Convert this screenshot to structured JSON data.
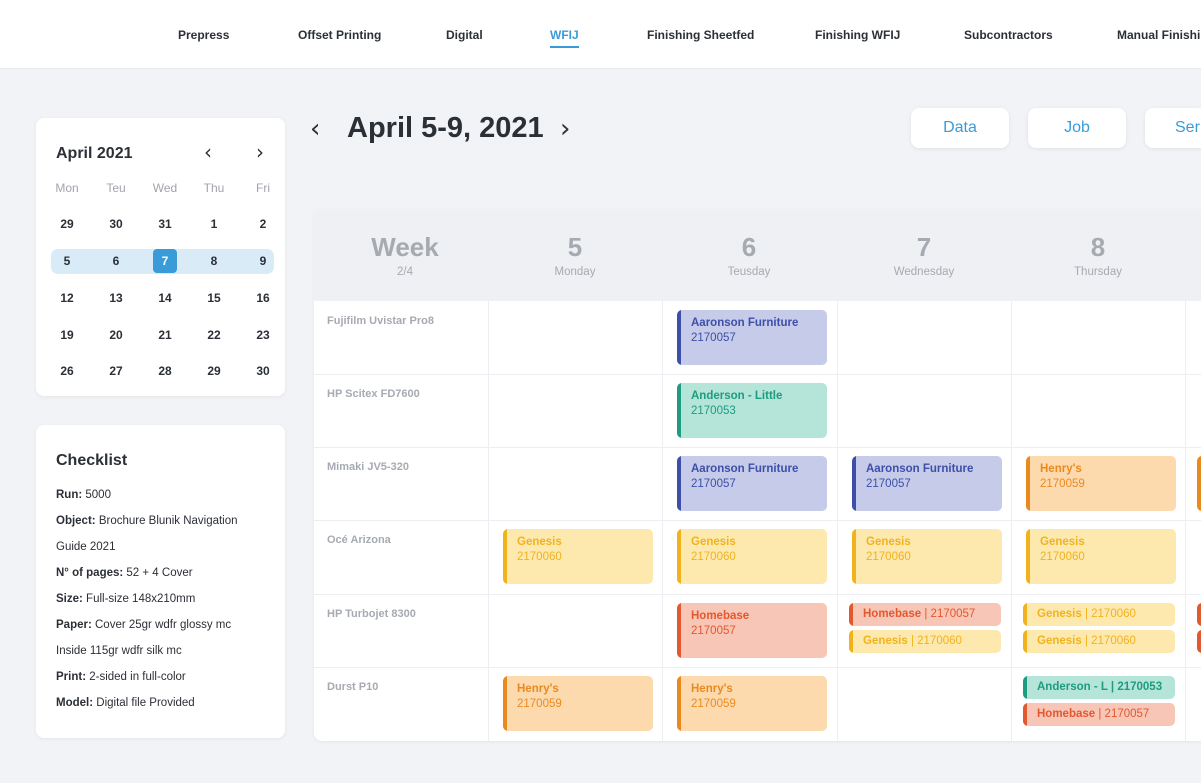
{
  "nav": {
    "items": [
      "Prepress",
      "Offset Printing",
      "Digital",
      "WFIJ",
      "Finishing Sheetfed",
      "Finishing WFIJ",
      "Subcontractors",
      "Manual Finishing"
    ],
    "active": "WFIJ"
  },
  "calendar": {
    "title": "April 2021",
    "prev_icon": "chevron-left-icon",
    "next_icon": "chevron-right-icon",
    "days_of_week": [
      "Mon",
      "Teu",
      "Wed",
      "Thu",
      "Fri"
    ],
    "weeks": [
      [
        "29",
        "30",
        "31",
        "1",
        "2"
      ],
      [
        "5",
        "6",
        "7",
        "8",
        "9"
      ],
      [
        "12",
        "13",
        "14",
        "15",
        "16"
      ],
      [
        "19",
        "20",
        "21",
        "22",
        "23"
      ],
      [
        "26",
        "27",
        "28",
        "29",
        "30"
      ]
    ],
    "selected_day": "7"
  },
  "checklist": {
    "title": "Checklist",
    "lines": [
      {
        "label": "Run:",
        "value": " 5000"
      },
      {
        "label": "Object:",
        "value": " Brochure Blunik Navigation"
      },
      {
        "label": "",
        "value": "Guide 2021"
      },
      {
        "label": "N° of pages:",
        "value": " 52 + 4 Cover"
      },
      {
        "label": "Size:",
        "value": " Full-size 148x210mm"
      },
      {
        "label": "Paper:",
        "value": " Cover 25gr wdfr glossy mc"
      },
      {
        "label": "",
        "value": "Inside 115gr wdfr silk mc"
      },
      {
        "label": "Print:",
        "value": " 2-sided in full-color"
      },
      {
        "label": "Model:",
        "value": " Digital file Provided"
      }
    ]
  },
  "header": {
    "title": "April 5-9, 2021",
    "prev_icon": "chevron-left-icon",
    "next_icon": "chevron-right-icon",
    "buttons": [
      "Data",
      "Job",
      "Ser"
    ]
  },
  "schedule": {
    "week_label": "Week",
    "week_sub": "2/4",
    "days": [
      {
        "num": "5",
        "name": "Monday"
      },
      {
        "num": "6",
        "name": "Teusday"
      },
      {
        "num": "7",
        "name": "Wednesday"
      },
      {
        "num": "8",
        "name": "Thursday"
      }
    ],
    "machines": [
      "Fujifilm Uvistar Pro8",
      "HP Scitex FD7600",
      "Mimaki JV5-320",
      "Océ Arizona",
      "HP Turbojet 8300",
      "Durst P10"
    ],
    "events": [
      {
        "row": 0,
        "day": 1,
        "color": "blue",
        "title": "Aaronson Furniture",
        "job": "2170057"
      },
      {
        "row": 1,
        "day": 1,
        "color": "teal",
        "title": "Anderson - Little",
        "job": "2170053"
      },
      {
        "row": 2,
        "day": 1,
        "color": "blue",
        "title": "Aaronson Furniture",
        "job": "2170057"
      },
      {
        "row": 2,
        "day": 2,
        "color": "blue",
        "title": "Aaronson Furniture",
        "job": "2170057"
      },
      {
        "row": 2,
        "day": 3,
        "color": "orange",
        "title": "Henry's",
        "job": "2170059"
      },
      {
        "row": 3,
        "day": 0,
        "color": "yellow",
        "title": "Genesis",
        "job": "2170060"
      },
      {
        "row": 3,
        "day": 1,
        "color": "yellow",
        "title": "Genesis",
        "job": "2170060"
      },
      {
        "row": 3,
        "day": 2,
        "color": "yellow",
        "title": "Genesis",
        "job": "2170060"
      },
      {
        "row": 3,
        "day": 3,
        "color": "yellow",
        "title": "Genesis",
        "job": "2170060"
      },
      {
        "row": 4,
        "day": 1,
        "color": "red",
        "title": "Homebase",
        "job": "2170057"
      },
      {
        "row": 5,
        "day": 0,
        "color": "orange",
        "title": "Henry's",
        "job": "2170059"
      },
      {
        "row": 5,
        "day": 1,
        "color": "orange",
        "title": "Henry's",
        "job": "2170059"
      }
    ],
    "small_events": [
      {
        "row": 4,
        "day": 2,
        "slot": 0,
        "color": "red",
        "title": "Homebase",
        "job": " | 2170057"
      },
      {
        "row": 4,
        "day": 2,
        "slot": 1,
        "color": "yellow",
        "title": "Genesis",
        "job": " | 2170060"
      },
      {
        "row": 4,
        "day": 3,
        "slot": 0,
        "color": "yellow",
        "title": "Genesis",
        "job": " | 2170060"
      },
      {
        "row": 4,
        "day": 3,
        "slot": 1,
        "color": "yellow",
        "title": "Genesis",
        "job": " | 2170060"
      },
      {
        "row": 5,
        "day": 3,
        "slot": 0,
        "color": "teal",
        "title": "Anderson - L | 2170053",
        "job": ""
      },
      {
        "row": 5,
        "day": 3,
        "slot": 1,
        "color": "red",
        "title": "Homebase",
        "job": " | 2170057"
      }
    ],
    "partial_cols": [
      {
        "row": 2,
        "color": "orange"
      },
      {
        "row": 4,
        "color": "red"
      }
    ]
  },
  "colors": {
    "accent": "#3a9bd9",
    "blue": "#3d4fa8",
    "teal": "#1d9c80",
    "yellow": "#f2b21d",
    "orange": "#ea8a1e",
    "red": "#e2582f"
  }
}
